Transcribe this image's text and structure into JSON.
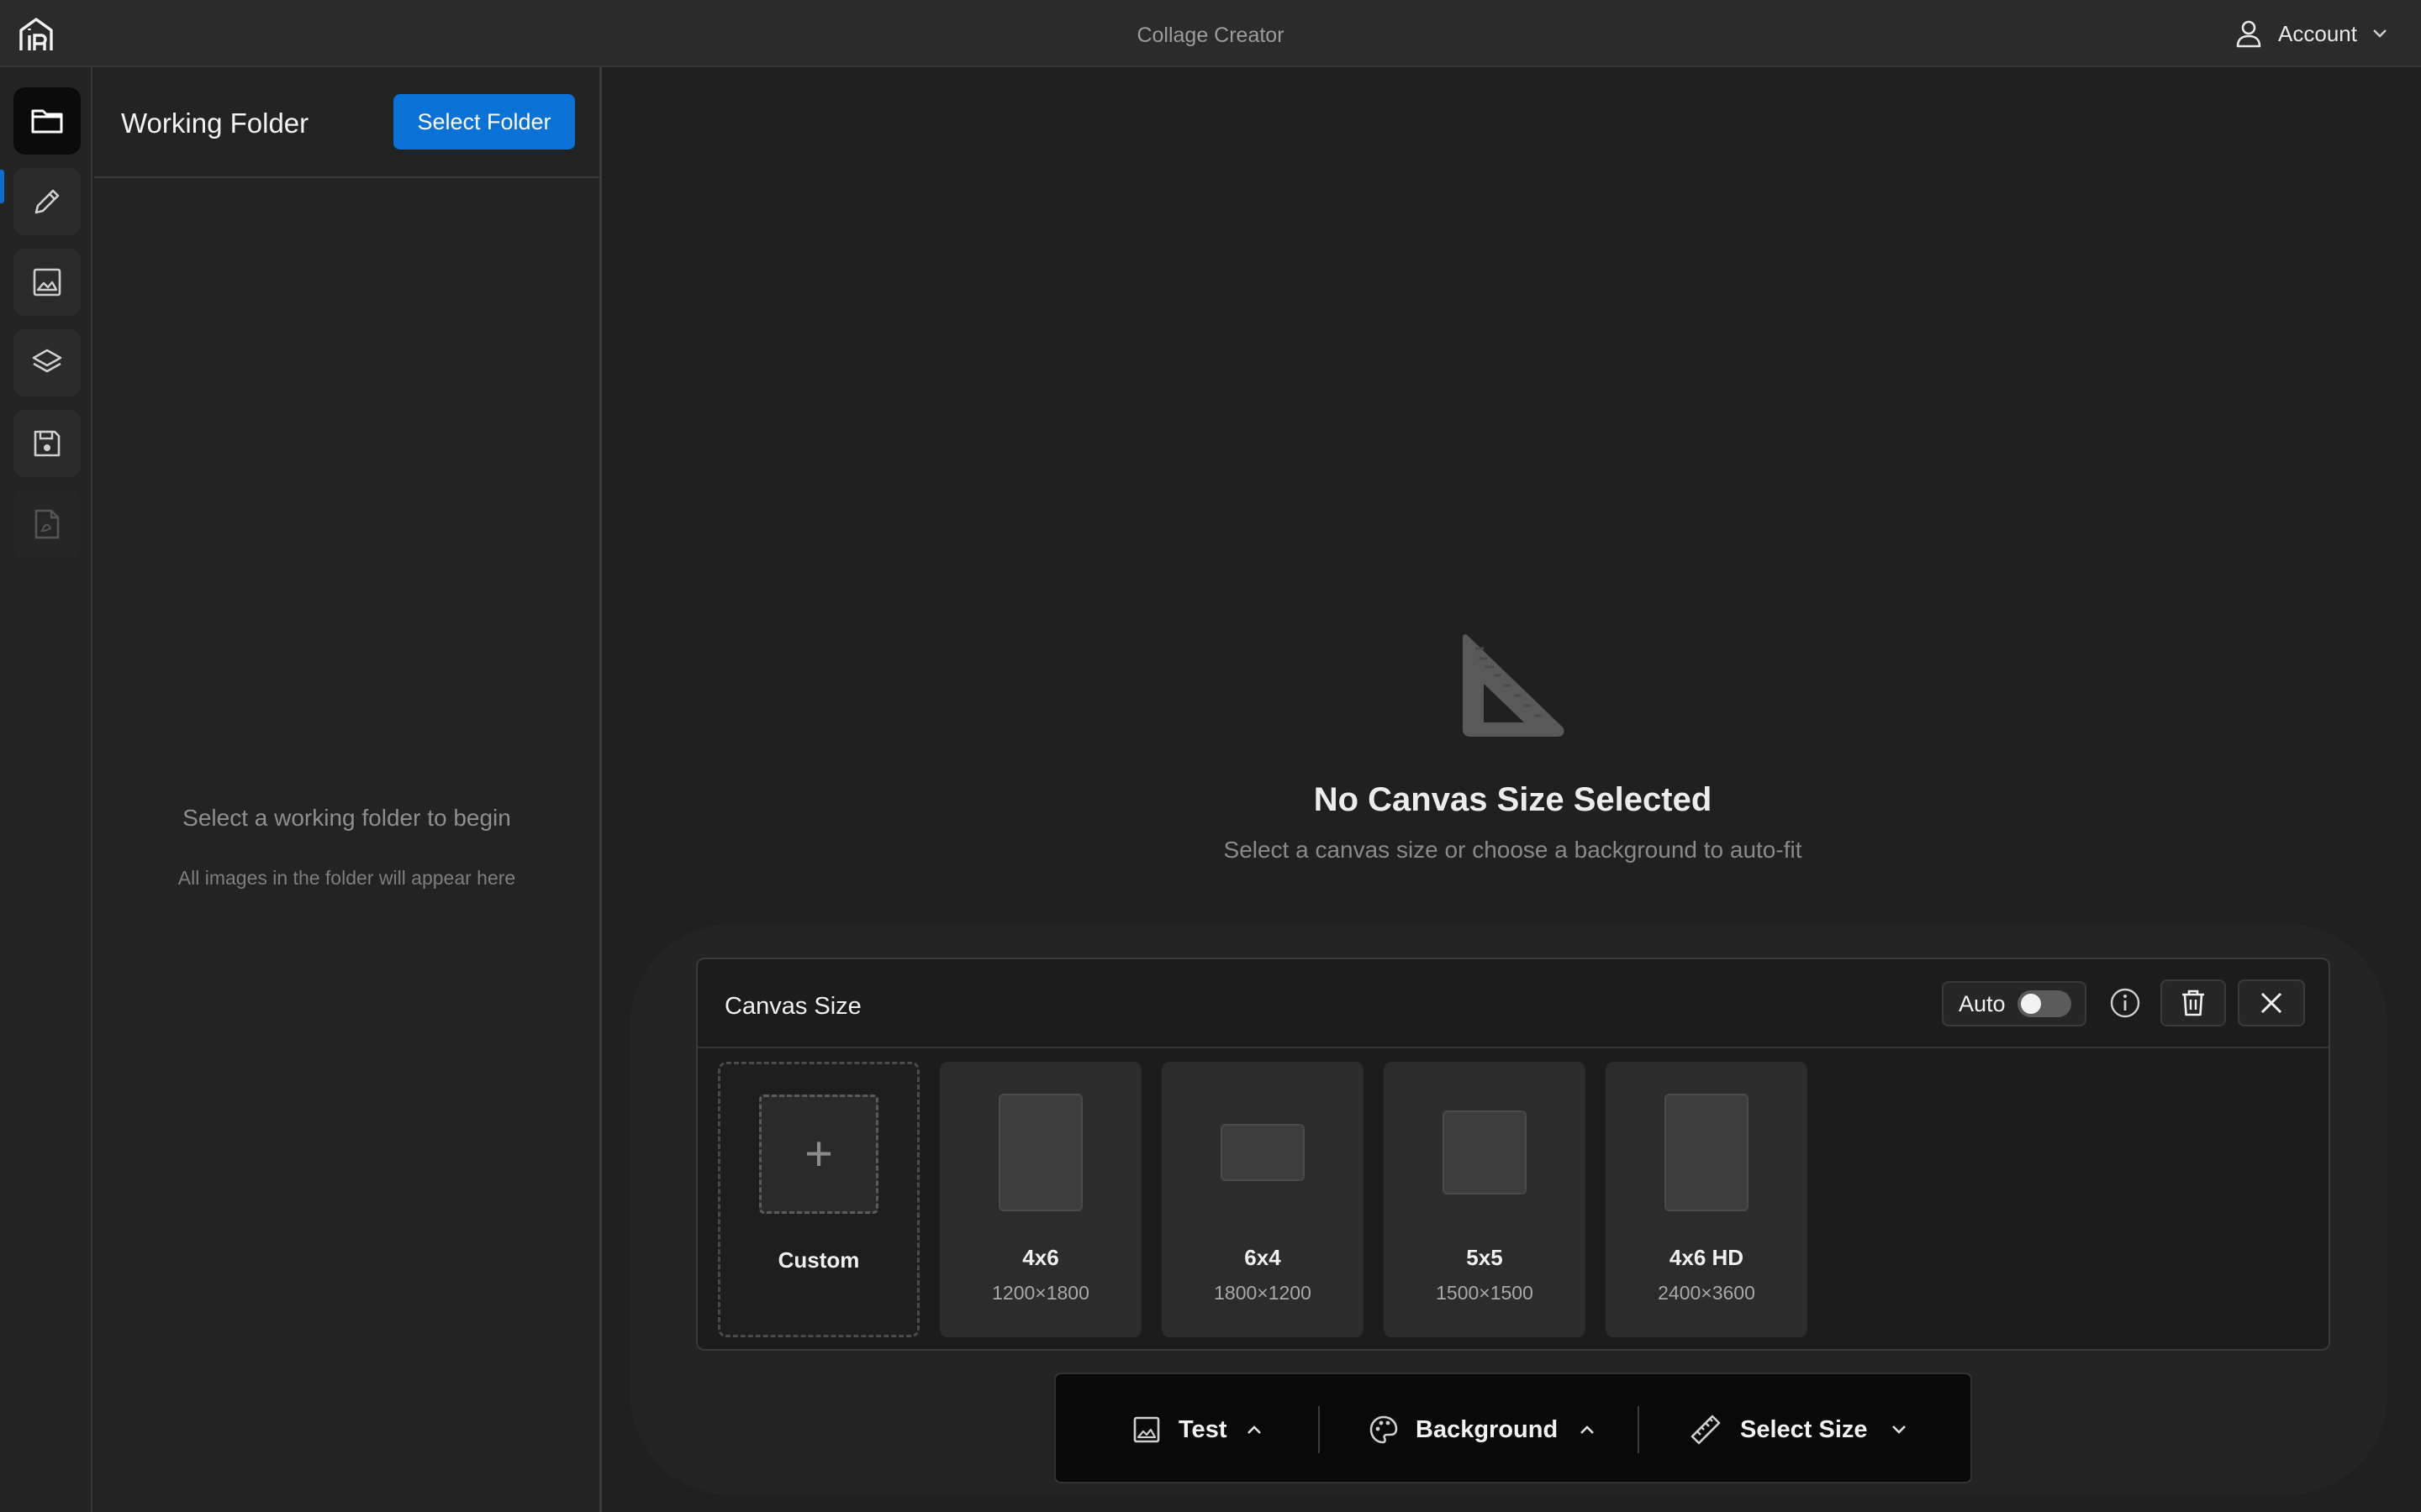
{
  "titlebar": {
    "app_title": "Collage Creator",
    "account_label": "Account"
  },
  "rail": {
    "items": [
      {
        "name": "folder",
        "state": "active"
      },
      {
        "name": "edit",
        "state": "normal"
      },
      {
        "name": "image",
        "state": "normal"
      },
      {
        "name": "layers",
        "state": "normal"
      },
      {
        "name": "save",
        "state": "normal"
      },
      {
        "name": "export-pdf",
        "state": "disabled"
      }
    ]
  },
  "panel": {
    "title": "Working Folder",
    "select_button": "Select Folder",
    "empty_title": "Select a working folder to begin",
    "empty_subtitle": "All images in the folder will appear here"
  },
  "main": {
    "placeholder_title": "No Canvas Size Selected",
    "placeholder_subtitle": "Select a canvas size or choose a background to auto-fit"
  },
  "canvas_size": {
    "title": "Canvas Size",
    "auto_label": "Auto",
    "auto_enabled": false,
    "cards": [
      {
        "name": "Custom",
        "dims": ""
      },
      {
        "name": "4x6",
        "dims": "1200×1800"
      },
      {
        "name": "6x4",
        "dims": "1800×1200"
      },
      {
        "name": "5x5",
        "dims": "1500×1500"
      },
      {
        "name": "4x6 HD",
        "dims": "2400×3600"
      }
    ]
  },
  "toolbar": {
    "test_label": "Test",
    "background_label": "Background",
    "size_label": "Select Size"
  },
  "colors": {
    "accent": "#0a72d6",
    "background": "#202020",
    "titlebar": "#2b2b2b"
  }
}
